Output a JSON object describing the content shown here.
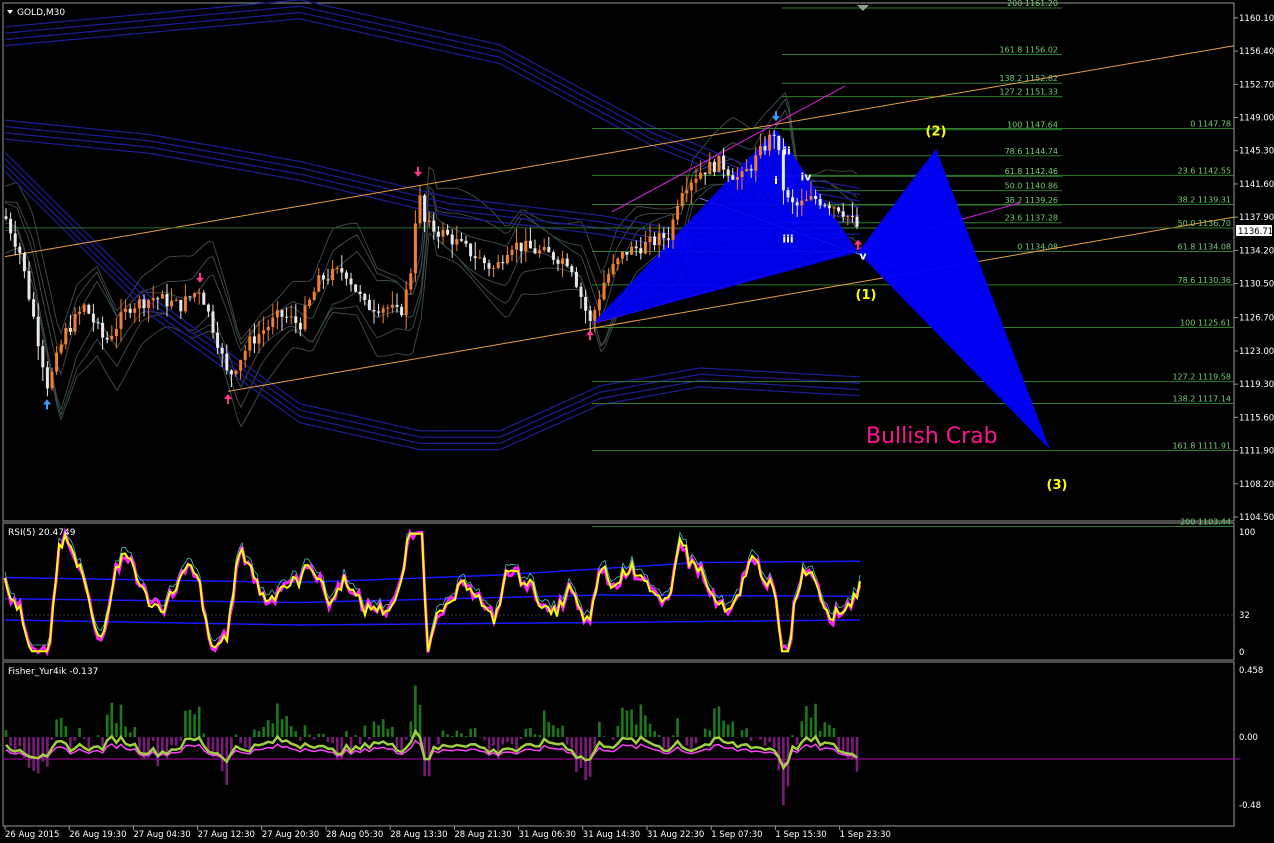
{
  "chart_title": "GOLD,M30",
  "current_price": "1136.71",
  "price_axis": [
    "1160.10",
    "1156.40",
    "1152.70",
    "1149.00",
    "1145.30",
    "1141.60",
    "1137.90",
    "1134.20",
    "1130.50",
    "1126.70",
    "1123.00",
    "1119.30",
    "1115.60",
    "1111.90",
    "1108.20",
    "1104.50"
  ],
  "time_axis": [
    "26 Aug 2015",
    "26 Aug 19:30",
    "27 Aug 04:30",
    "27 Aug 12:30",
    "27 Aug 20:30",
    "28 Aug 05:30",
    "28 Aug 13:30",
    "28 Aug 21:30",
    "31 Aug 06:30",
    "31 Aug 14:30",
    "31 Aug 22:30",
    "1 Sep 07:30",
    "1 Sep 15:30",
    "1 Sep 23:30"
  ],
  "fib_left": [
    {
      "ratio": "200",
      "price": "1161.20"
    },
    {
      "ratio": "161.8",
      "price": "1156.02"
    },
    {
      "ratio": "138.2",
      "price": "1152.82"
    },
    {
      "ratio": "127.2",
      "price": "1151.33"
    },
    {
      "ratio": "100",
      "price": "1147.64"
    },
    {
      "ratio": "78.6",
      "price": "1144.74"
    },
    {
      "ratio": "61.8",
      "price": "1142.46"
    },
    {
      "ratio": "50.0",
      "price": "1140.86"
    },
    {
      "ratio": "38.2",
      "price": "1139.26"
    },
    {
      "ratio": "23.6",
      "price": "1137.28"
    },
    {
      "ratio": "0",
      "price": "1134.08"
    }
  ],
  "fib_right": [
    {
      "ratio": "0",
      "price": "1147.78"
    },
    {
      "ratio": "23.6",
      "price": "1142.55"
    },
    {
      "ratio": "38.2",
      "price": "1139.31"
    },
    {
      "ratio": "50.0",
      "price": "1136.70"
    },
    {
      "ratio": "61.8",
      "price": "1134.08"
    },
    {
      "ratio": "78.6",
      "price": "1130.36"
    },
    {
      "ratio": "100",
      "price": "1125.61"
    },
    {
      "ratio": "127.2",
      "price": "1119.58"
    },
    {
      "ratio": "138.2",
      "price": "1117.14"
    },
    {
      "ratio": "161.8",
      "price": "1111.91"
    },
    {
      "ratio": "200",
      "price": "1103.44"
    }
  ],
  "wave_labels": {
    "i": "i",
    "ii": "ii",
    "iii": "iii",
    "iv": "iv",
    "v": "v",
    "w1": "(1)",
    "w2": "(2)",
    "w3": "(3)"
  },
  "pattern_label": "Bullish Crab",
  "rsi": {
    "title": "RSI(5) 20.4749",
    "levels": [
      "100",
      "32",
      "0"
    ]
  },
  "fisher": {
    "title": "Fisher_Yur4ik -0.137",
    "levels": [
      "0.458",
      "0.00",
      "-0.48"
    ]
  },
  "colors": {
    "bull": "#f08030",
    "bear": "#e8e8e8",
    "fib": "#2e7d2e",
    "trend": "#e8a040",
    "pattern": "#0000ff",
    "band": "#1c1c8c",
    "channel": "#3a4a48",
    "rsi": "#ffff00",
    "fisher_pos": "#1a7a1a",
    "fisher_neg": "#7a1a7a",
    "label": "#ff1493",
    "wave": "#ffff00"
  },
  "chart_data": {
    "type": "line",
    "symbol": "GOLD",
    "timeframe": "M30",
    "last_price": 1136.71,
    "ylim": [
      1104.5,
      1161.2
    ],
    "x": [
      "26 Aug 2015",
      "26 Aug 19:30",
      "27 Aug 04:30",
      "27 Aug 12:30",
      "27 Aug 20:30",
      "28 Aug 05:30",
      "28 Aug 13:30",
      "28 Aug 21:30",
      "31 Aug 06:30",
      "31 Aug 14:30",
      "31 Aug 22:30",
      "1 Sep 07:30",
      "1 Sep 15:30",
      "1 Sep 23:30"
    ],
    "series": [
      {
        "name": "GOLD,M30",
        "values": [
          1138.0,
          1123.5,
          1127.5,
          1120.0,
          1128.5,
          1133.0,
          1138.0,
          1135.5,
          1134.5,
          1127.0,
          1135.0,
          1143.5,
          1146.0,
          1136.7
        ]
      }
    ],
    "pattern": {
      "name": "Bullish Crab",
      "points": {
        "(1)": 1134.08,
        "(2)": 1145.3,
        "(3)": 1112.0
      }
    }
  }
}
